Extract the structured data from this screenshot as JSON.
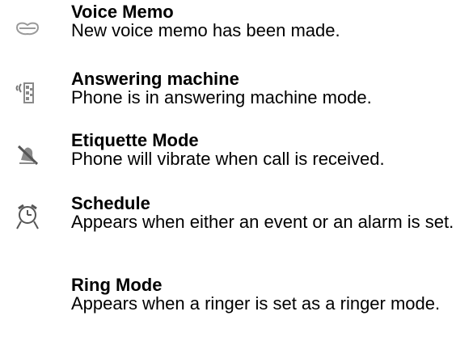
{
  "entries": [
    {
      "icon": "voice-memo-icon",
      "title": "Voice Memo",
      "description": "New voice memo has been made."
    },
    {
      "icon": "answering-machine-icon",
      "title": "Answering machine",
      "description": "Phone is in answering machine mode."
    },
    {
      "icon": "etiquette-mode-icon",
      "title": "Etiquette Mode",
      "description": "Phone will vibrate when call is received."
    },
    {
      "icon": "alarm-clock-icon",
      "title": "Schedule",
      "description": "Appears when either an event or an alarm is set."
    },
    {
      "icon": "none",
      "title": "Ring Mode",
      "description": "Appears when a ringer is set as a ringer mode."
    }
  ]
}
